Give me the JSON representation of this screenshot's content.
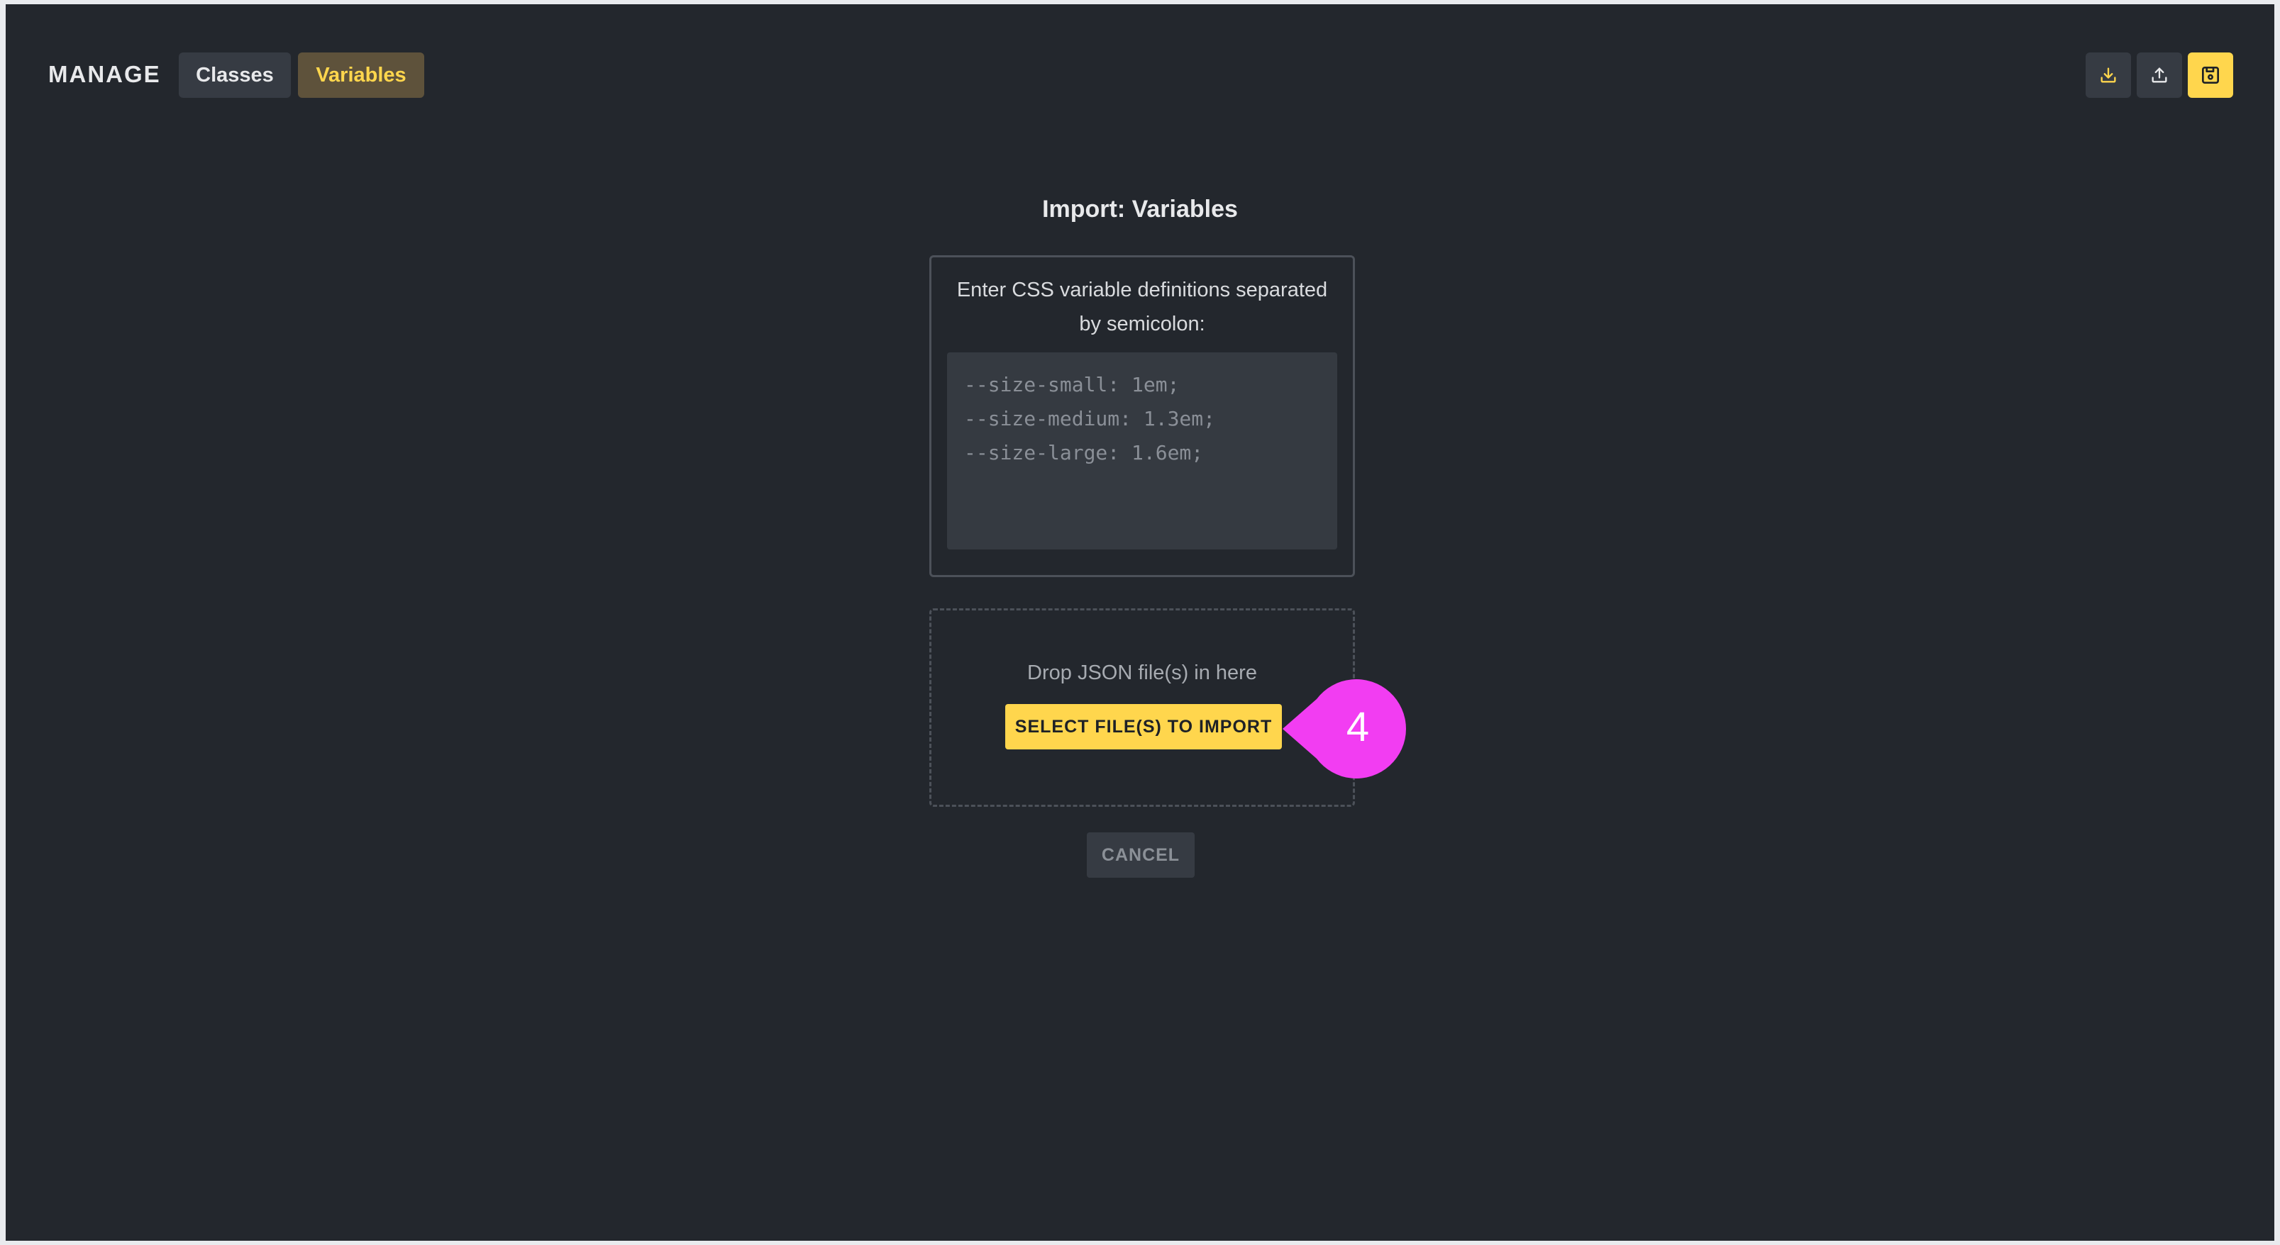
{
  "header": {
    "brand": "MANAGE",
    "tabs": [
      {
        "label": "Classes",
        "active": false
      },
      {
        "label": "Variables",
        "active": true
      }
    ],
    "actions": [
      {
        "icon": "download-icon"
      },
      {
        "icon": "upload-icon"
      },
      {
        "icon": "save-icon",
        "active": true
      }
    ]
  },
  "import": {
    "title": "Import: Variables",
    "instruction": "Enter CSS variable definitions separated by semicolon:",
    "textarea_placeholder": "--size-small: 1em;\n--size-medium: 1.3em;\n--size-large: 1.6em;",
    "drop_text": "Drop JSON file(s) in here",
    "select_label": "SELECT FILE(S) TO IMPORT",
    "cancel_label": "CANCEL"
  },
  "step_badge": {
    "number": "4",
    "color": "#f23df2"
  },
  "colors": {
    "background": "#23272d",
    "accent": "#ffd64d",
    "tab_bg": "#363b43",
    "active_tab_bg": "#5e523b"
  }
}
